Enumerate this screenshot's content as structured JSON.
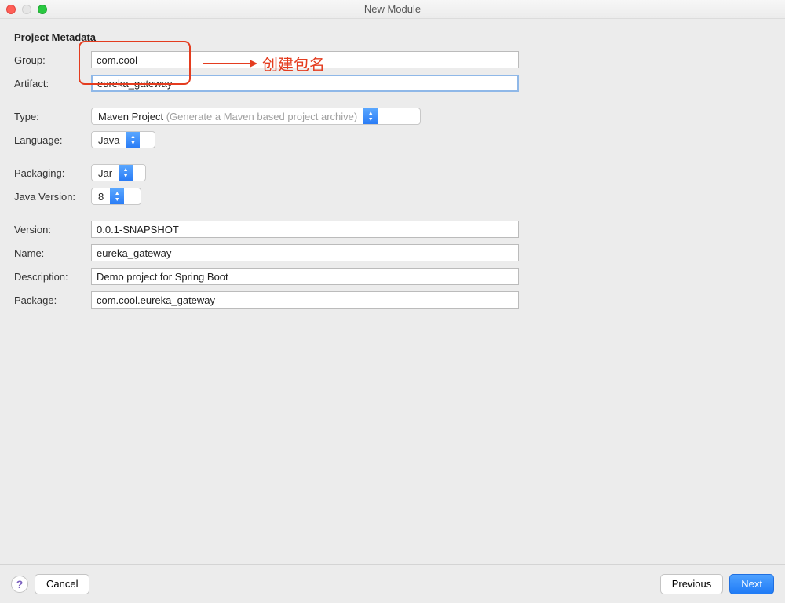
{
  "window": {
    "title": "New Module"
  },
  "section": {
    "title": "Project Metadata"
  },
  "labels": {
    "group": "Group:",
    "artifact": "Artifact:",
    "type": "Type:",
    "language": "Language:",
    "packaging": "Packaging:",
    "javaVersion": "Java Version:",
    "version": "Version:",
    "name": "Name:",
    "description": "Description:",
    "package": "Package:"
  },
  "fields": {
    "group": "com.cool",
    "artifact": "eureka_gateway",
    "type": {
      "value": "Maven Project",
      "hint": "(Generate a Maven based project archive)"
    },
    "language": "Java",
    "packaging": "Jar",
    "javaVersion": "8",
    "version": "0.0.1-SNAPSHOT",
    "name": "eureka_gateway",
    "description": "Demo project for Spring Boot",
    "package": "com.cool.eureka_gateway"
  },
  "annotation": {
    "text": "创建包名"
  },
  "footer": {
    "help": "?",
    "cancel": "Cancel",
    "previous": "Previous",
    "next": "Next"
  }
}
